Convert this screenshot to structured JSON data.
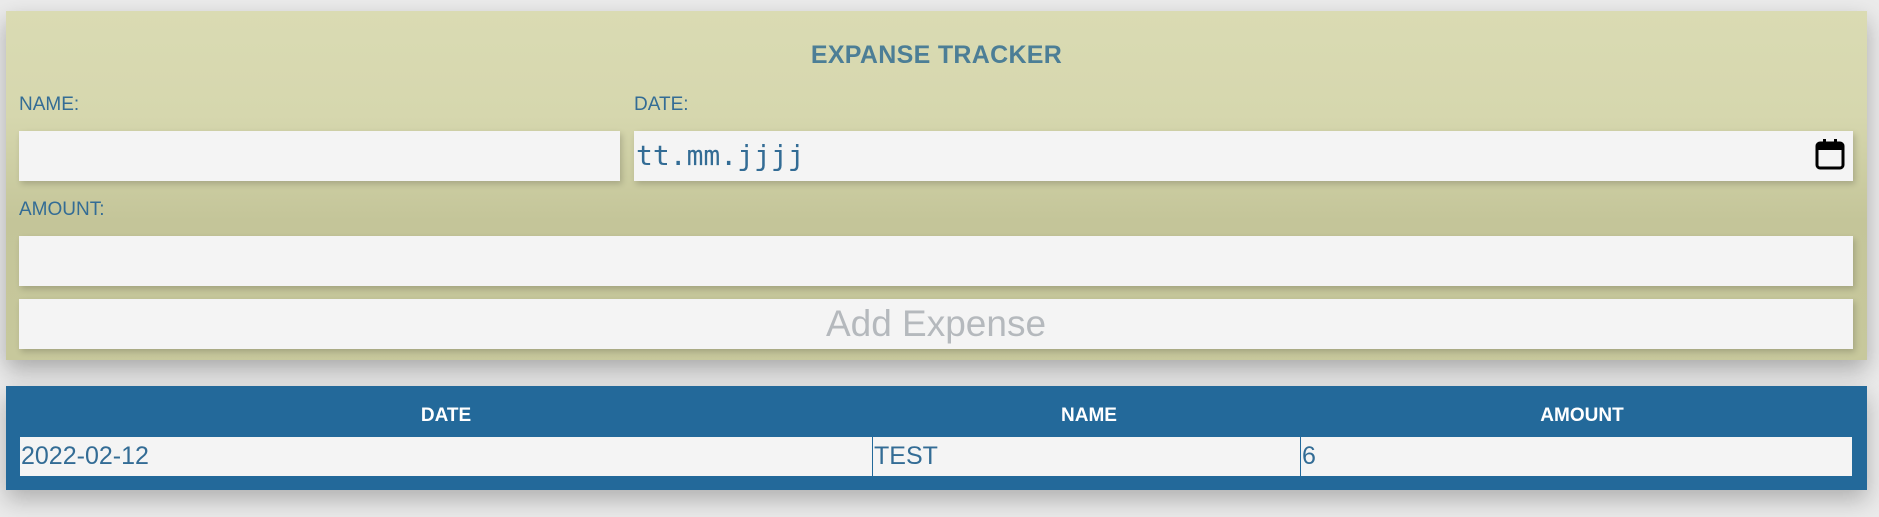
{
  "form": {
    "title": "EXPANSE TRACKER",
    "name_label": "NAME:",
    "name_value": "",
    "date_label": "DATE:",
    "date_placeholder": "tt.mm.jjjj",
    "amount_label": "AMOUNT:",
    "amount_value": "",
    "add_button_label": "Add Expense"
  },
  "table": {
    "headers": [
      "DATE",
      "NAME",
      "AMOUNT"
    ],
    "rows": [
      {
        "date": "2022-02-12",
        "name": "TEST",
        "amount": "6"
      }
    ]
  },
  "colors": {
    "form_background": "#d6d7ae",
    "accent_text": "#336c95",
    "table_header": "#23699a",
    "field_background": "#f4f4f4"
  },
  "icons": {
    "date_picker": "calendar-icon"
  }
}
